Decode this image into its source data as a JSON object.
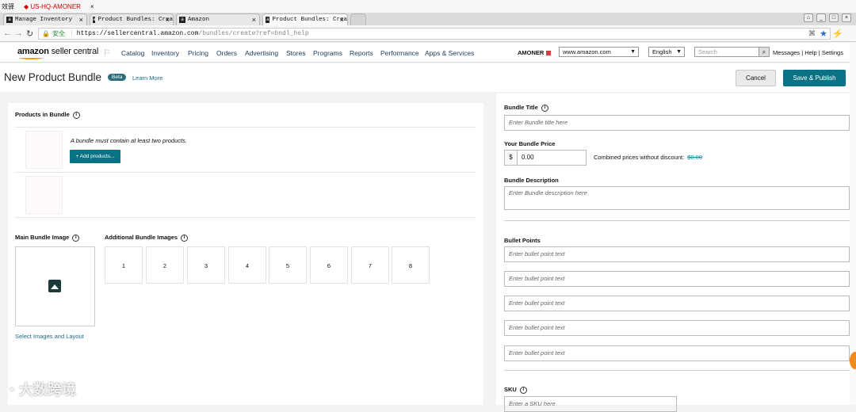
{
  "bookmarks": {
    "item1": "效驿",
    "item2": "◆ US-HQ-AMONER"
  },
  "tabs": [
    {
      "label": "Manage Inventory",
      "icon": "amazon-a-icon"
    },
    {
      "label": "Product Bundles: Crea",
      "icon": "amazon-a-icon"
    },
    {
      "label": "Amazon",
      "icon": "amazon-a-icon"
    },
    {
      "label": "Product Bundles: Crea",
      "icon": "amazon-a-icon"
    }
  ],
  "address": {
    "secure": "安全",
    "url_host": "https://sellercentral.amazon.com",
    "url_path": "/bundles/create?ref=bndl_help"
  },
  "header": {
    "logo_amazon": "amazon",
    "logo_sc": " seller central",
    "nav": [
      "Catalog",
      "Inventory",
      "Pricing",
      "Orders",
      "Advertising",
      "Stores",
      "Programs",
      "Reports",
      "Performance",
      "Apps & Services"
    ],
    "store": "AMONER",
    "marketplace": "www.amazon.com",
    "language": "English",
    "search_placeholder": "Search",
    "links": "Messages | Help | Settings"
  },
  "page": {
    "title": "New Product Bundle",
    "beta": "Beta",
    "learn_more": "Learn More",
    "cancel": "Cancel",
    "publish": "Save & Publish"
  },
  "left": {
    "products_label": "Products in Bundle",
    "must_contain": "A bundle must contain at least two products.",
    "add_products": "+ Add products...",
    "main_image_label": "Main Bundle Image",
    "additional_label": "Additional Bundle Images",
    "slots": [
      "1",
      "2",
      "3",
      "4",
      "5",
      "6",
      "7",
      "8"
    ],
    "select_images": "Select Images and Layout"
  },
  "right": {
    "bundle_title_label": "Bundle Title",
    "bundle_title_ph": "Enter Bundle title here",
    "price_label": "Your Bundle Price",
    "currency": "$",
    "price_value": "0.00",
    "combined_label": "Combined prices without discount:",
    "combined_value": "$0.00",
    "desc_label": "Bundle Description",
    "desc_ph": "Enter Bundle description here",
    "bullets_label": "Bullet Points",
    "bullet_ph": "Enter bullet point text",
    "sku_label": "SKU",
    "sku_ph": "Enter a SKU here"
  },
  "watermark": "大数跨境"
}
